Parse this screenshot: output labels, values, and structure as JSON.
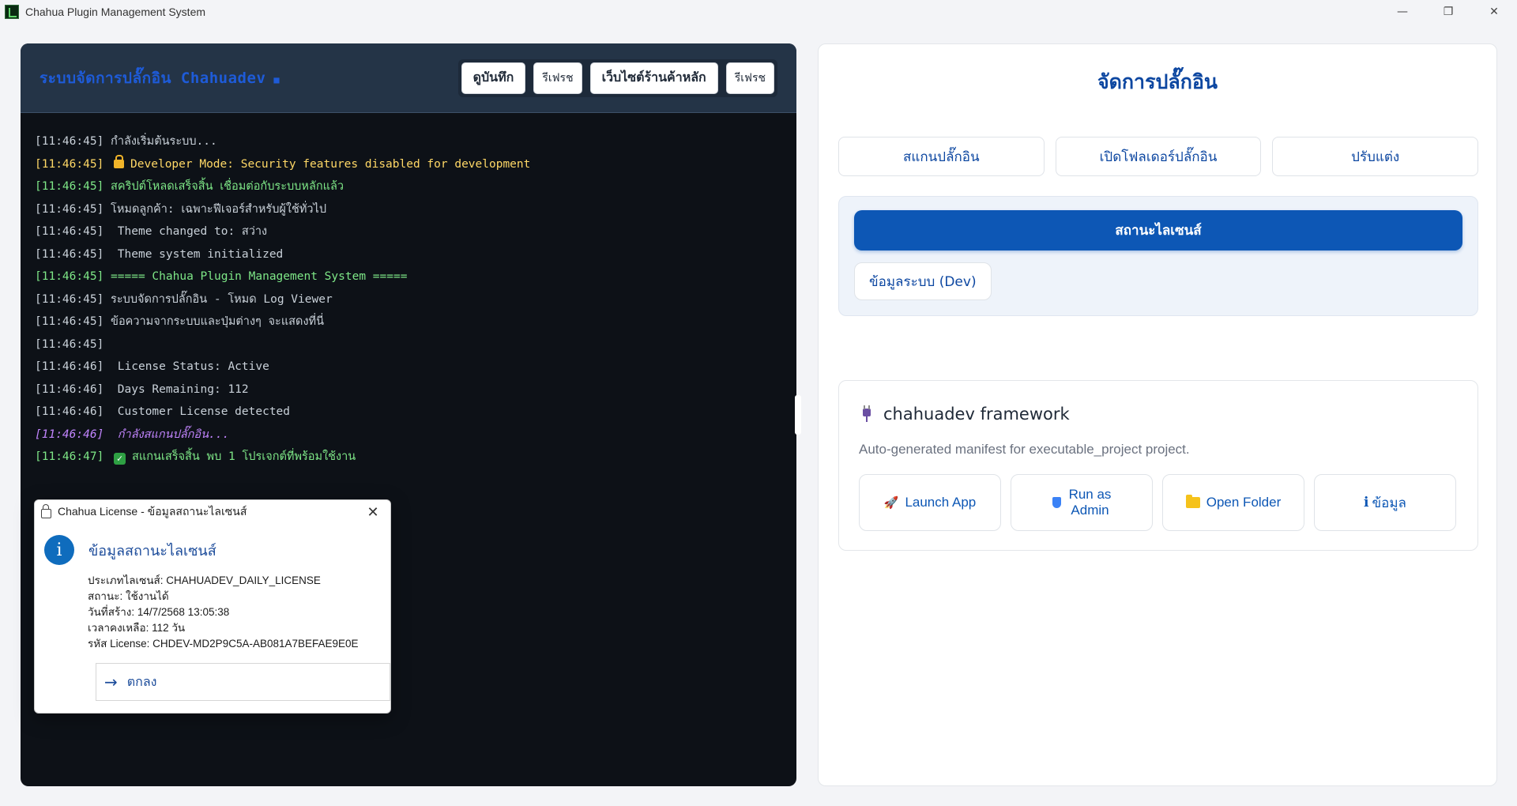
{
  "window": {
    "title": "Chahua Plugin Management System",
    "controls": {
      "minimize": "—",
      "restore": "❐",
      "close": "✕"
    }
  },
  "console": {
    "title": "ระบบจัดการปลั๊กอิน Chahuadev",
    "status_dot": "■",
    "buttons": {
      "view_log": "ดูบันทึก",
      "refresh1": "รีเฟรช",
      "main_store": "เว็บไซต์ร้านค้าหลัก",
      "refresh2": "รีเฟรช"
    },
    "lines": [
      {
        "ts": "[11:46:45]",
        "text": " กำลังเริ่มต้นระบบ..."
      },
      {
        "ts": "[11:46:45]",
        "text": "Developer Mode: Security features disabled for development"
      },
      {
        "ts": "[11:46:45]",
        "text": " สคริปต์โหลดเสร็จสิ้น เชื่อมต่อกับระบบหลักแล้ว"
      },
      {
        "ts": "[11:46:45]",
        "text": " โหมดลูกค้า: เฉพาะฟีเจอร์สำหรับผู้ใช้ทั่วไป"
      },
      {
        "ts": "[11:46:45]",
        "text": "  Theme changed to: สว่าง"
      },
      {
        "ts": "[11:46:45]",
        "text": "  Theme system initialized"
      },
      {
        "ts": "[11:46:45]",
        "text": " ===== Chahua Plugin Management System ====="
      },
      {
        "ts": "[11:46:45]",
        "text": " ระบบจัดการปลั๊กอิน - โหมด Log Viewer"
      },
      {
        "ts": "[11:46:45]",
        "text": " ข้อความจากระบบและปุ่มต่างๆ จะแสดงที่นี่"
      },
      {
        "ts": "[11:46:45]",
        "text": ""
      },
      {
        "ts": "[11:46:46]",
        "text": "  License Status: Active"
      },
      {
        "ts": "[11:46:46]",
        "text": "  Days Remaining: 112"
      },
      {
        "ts": "[11:46:46]",
        "text": "  Customer License detected"
      },
      {
        "ts": "[11:46:46]",
        "text": "  กำลังสแกนปลั๊กอิน..."
      },
      {
        "ts": "[11:46:47]",
        "text": "สแกนเสร็จสิ้น พบ 1 โปรเจกต์ที่พร้อมใช้งาน"
      }
    ]
  },
  "dialog": {
    "title": "Chahua License -  ข้อมูลสถานะไลเซนส์",
    "close": "✕",
    "heading": "ข้อมูลสถานะไลเซนส์",
    "info_icon": "i",
    "lines": [
      "ประเภทไลเซนส์: CHAHUADEV_DAILY_LICENSE",
      "สถานะ: ใช้งานได้",
      "วันที่สร้าง: 14/7/2568 13:05:38",
      "เวลาคงเหลือ: 112 วัน",
      "รหัส License: CHDEV-MD2P9C5A-AB081A7BEFAE9E0E"
    ],
    "ok_arrow": "→",
    "ok_label": "ตกลง"
  },
  "plugins": {
    "title": "จัดการปลั๊กอิน",
    "tabs": [
      "สแกนปลั๊กอิน",
      "เปิดโฟลเดอร์ปลั๊กอิน",
      "ปรับแต่ง"
    ],
    "license_button": "สถานะไลเซนส์",
    "system_info_button": "ข้อมูลระบบ (Dev)",
    "card": {
      "name": "chahuadev framework",
      "description": "Auto-generated manifest for executable_project project.",
      "actions": {
        "launch": "Launch App",
        "run_admin_1": "Run as",
        "run_admin_2": "Admin",
        "open_folder": "Open Folder",
        "info_icon": "i",
        "info": "ข้อมูล"
      }
    }
  },
  "colors": {
    "console_bg": "#0d1117",
    "console_header": "#243447",
    "accent_blue": "#0d57b5",
    "log_yellow": "#ffd866",
    "log_green": "#7ee787",
    "log_purple": "#c084fc"
  },
  "icons": [
    "app-icon",
    "lock-icon",
    "check-icon",
    "info-icon",
    "plug-icon",
    "rocket-icon",
    "shield-icon",
    "folder-icon",
    "info-small-icon",
    "close-icon",
    "arrow-right-icon"
  ]
}
